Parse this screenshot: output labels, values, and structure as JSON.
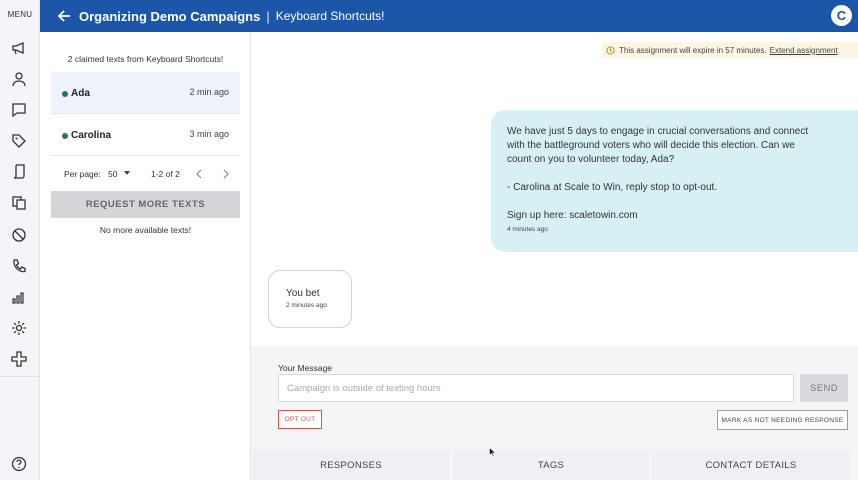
{
  "rail": {
    "menu_label": "MENU",
    "icons": [
      "megaphone-icon",
      "person-icon",
      "chat-icon",
      "tag-icon",
      "phone-script-icon",
      "copy-icon",
      "block-icon",
      "phone-icon",
      "chart-icon",
      "gear-icon",
      "plus-icon"
    ],
    "help_icon": "help-icon"
  },
  "header": {
    "title": "Organizing Demo Campaigns",
    "separator": "|",
    "subtitle": "Keyboard Shortcuts!",
    "avatar_letter": "C",
    "color": "#1c56a8"
  },
  "list": {
    "claimed_text": "2 claimed texts from Keyboard Shortcuts!",
    "conversations": [
      {
        "name": "Ada",
        "time": "2 min ago",
        "active": true
      },
      {
        "name": "Carolina",
        "time": "3 min ago",
        "active": false
      }
    ],
    "pager": {
      "label": "Per page:",
      "per_page": "50",
      "range": "1-2 of 2"
    },
    "request_button": "REQUEST MORE TEXTS",
    "no_more": "No more available texts!"
  },
  "thread": {
    "expire_notice": "This assignment will expire in 57 minutes.",
    "extend_link": "Extend assignment",
    "outgoing": {
      "line1": "We have just 5 days to engage in crucial conversations and connect",
      "line2": "with the battleground voters who will decide this election. Can we",
      "line3": "count on you to volunteer today, Ada?",
      "line4": "- Carolina at Scale to Win, reply stop to opt-out.",
      "line5": "Sign up here: scaletowin.com",
      "timestamp": "4 minutes ago"
    },
    "incoming": {
      "text": "You bet",
      "timestamp": "2 minutes ago"
    }
  },
  "composer": {
    "label": "Your Message",
    "placeholder": "Campaign is outside of texting hours",
    "send": "SEND",
    "opt_out": "OPT OUT",
    "mark_not_needing": "MARK AS NOT NEEDING RESPONSE"
  },
  "tabs": [
    "RESPONSES",
    "TAGS",
    "CONTACT DETAILS"
  ]
}
